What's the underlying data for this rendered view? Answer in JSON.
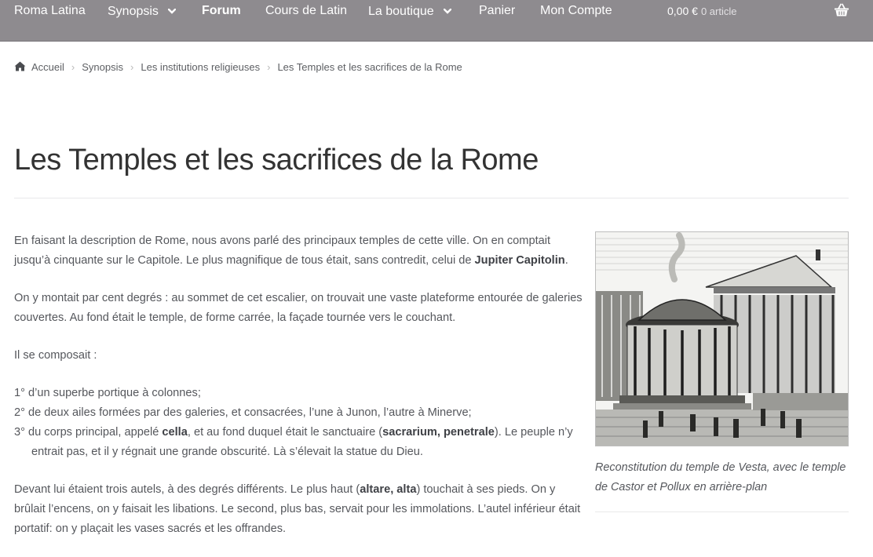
{
  "nav": {
    "items": [
      {
        "label": "Roma Latina"
      },
      {
        "label": "Synopsis"
      },
      {
        "label": "Forum"
      },
      {
        "label": "Cours de Latin"
      },
      {
        "label": "La boutique"
      },
      {
        "label": "Panier"
      },
      {
        "label": "Mon Compte"
      }
    ],
    "cart_total": "0,00 €",
    "cart_count": "0 article",
    "icons": {
      "dropdown": "chevron-down-icon",
      "cart": "basket-icon"
    }
  },
  "breadcrumb": {
    "home_icon": "home-icon",
    "items": [
      "Accueil",
      "Synopsis",
      "Les institutions religieuses",
      "Les Temples et les sacrifices de la Rome"
    ],
    "separator": "›"
  },
  "page": {
    "title": "Les Temples et les sacrifices de la Rome"
  },
  "article": {
    "p1_text": "En faisant la description de Rome, nous avons parlé des principaux temples de cette ville. On en comptait jusqu’à cinquante sur le Capitole. Le plus magnifique de tous était, sans contredit, celui de ",
    "p1_bold": "Jupiter Capitolin",
    "p1_end": ".",
    "p2": "On y montait par cent degrés : au sommet de cet escalier, on trouvait une vaste plateforme entourée de galeries couvertes. Au fond était le temple, de forme carrée, la façade tournée vers le couchant.",
    "p3": "Il se composait :",
    "list": {
      "item1": "1° d’un superbe portique à colonnes;",
      "item2": "2° de deux ailes formées par des galeries, et consacrées, l’une à Junon, l’autre à Minerve;",
      "item3_a": "3° du corps principal, appelé ",
      "item3_b": "cella",
      "item3_c": ", et au fond duquel était le sanctuaire (",
      "item3_d": "sacrarium, penetrale",
      "item3_e": "). Le peuple n’y entrait pas, et il y régnait une grande obscurité. Là s’élevait la statue du Dieu."
    },
    "p4_a": "Devant lui étaient trois autels, à des degrés différents. Le plus haut (",
    "p4_b": "altare, alta",
    "p4_c": ") touchait à ses pieds. On y brûlait l’encens, on y faisait les libations. Le second, plus bas, servait pour les immolations. L’autel inférieur était portatif: on y plaçait les vases sacrés et les offrandes."
  },
  "figure": {
    "caption": "Reconstitution du temple de Vesta, avec le temple de Castor et Pollux en arrière-plan"
  },
  "colors": {
    "topbar": "#8e8b8f",
    "text": "#55575c",
    "title": "#333333"
  }
}
